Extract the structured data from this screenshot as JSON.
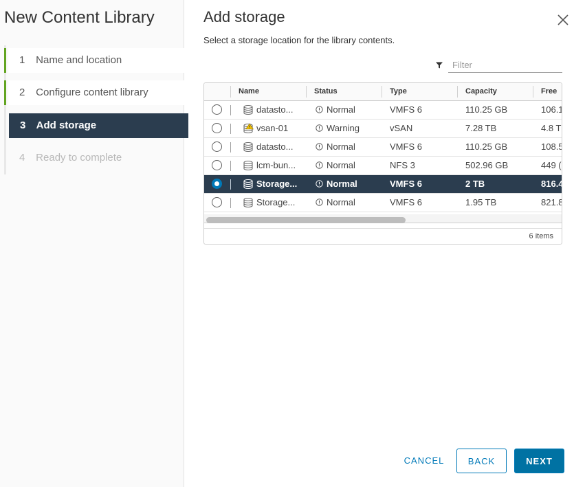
{
  "wizard": {
    "title": "New Content Library",
    "steps": [
      {
        "num": "1",
        "label": "Name and location"
      },
      {
        "num": "2",
        "label": "Configure content library"
      },
      {
        "num": "3",
        "label": "Add storage"
      },
      {
        "num": "4",
        "label": "Ready to complete"
      }
    ]
  },
  "main": {
    "title": "Add storage",
    "subtitle": "Select a storage location for the library contents.",
    "filter": {
      "placeholder": "Filter",
      "value": ""
    }
  },
  "grid": {
    "columns": [
      "Name",
      "Status",
      "Type",
      "Capacity",
      "Free"
    ],
    "rows": [
      {
        "name": "datasto...",
        "status": "Normal",
        "type": "VMFS 6",
        "capacity": "110.25 GB",
        "free": "106.1",
        "selected": false,
        "icon": "datastore-icon"
      },
      {
        "name": "vsan-01",
        "status": "Warning",
        "type": "vSAN",
        "capacity": "7.28 TB",
        "free": "4.8 T",
        "selected": false,
        "icon": "datastore-warning-icon"
      },
      {
        "name": "datasto...",
        "status": "Normal",
        "type": "VMFS 6",
        "capacity": "110.25 GB",
        "free": "108.5",
        "selected": false,
        "icon": "datastore-icon"
      },
      {
        "name": "lcm-bun...",
        "status": "Normal",
        "type": "NFS 3",
        "capacity": "502.96 GB",
        "free": "449 (",
        "selected": false,
        "icon": "datastore-icon"
      },
      {
        "name": "Storage...",
        "status": "Normal",
        "type": "VMFS 6",
        "capacity": "2 TB",
        "free": "816.4",
        "selected": true,
        "icon": "datastore-icon"
      },
      {
        "name": "Storage...",
        "status": "Normal",
        "type": "VMFS 6",
        "capacity": "1.95 TB",
        "free": "821.8",
        "selected": false,
        "icon": "datastore-icon"
      }
    ],
    "footer": "6 items"
  },
  "buttons": {
    "cancel": "CANCEL",
    "back": "BACK",
    "next": "NEXT"
  },
  "colors": {
    "accent": "#0079b8",
    "selected_row": "#2b3d4f",
    "completed_step": "#62a420",
    "warning": "#efc006"
  }
}
